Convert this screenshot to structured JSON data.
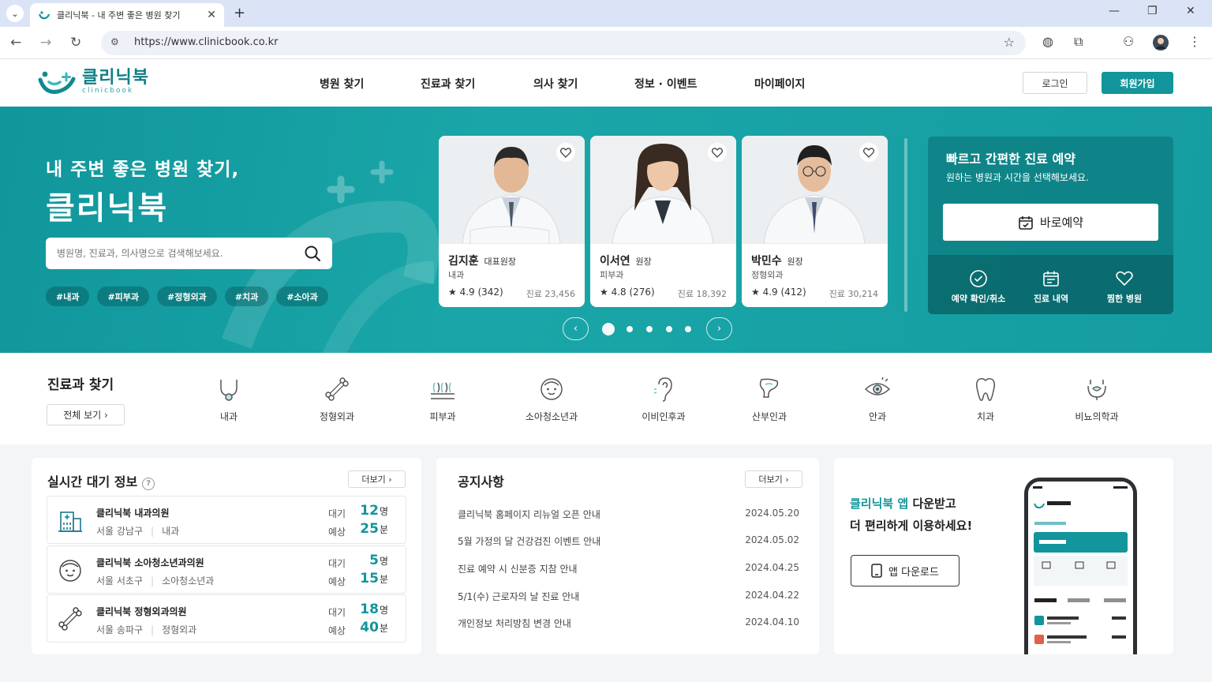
{
  "browser": {
    "tab_title": "클리닉북 - 내 주변 좋은 병원 찾기",
    "url": "https://www.clinicbook.co.kr"
  },
  "header": {
    "logo_ko": "클리닉북",
    "logo_en": "clinicbook",
    "nav": [
      "병원 찾기",
      "진료과 찾기",
      "의사 찾기",
      "정보 · 이벤트",
      "마이페이지"
    ],
    "login": "로그인",
    "signup": "회원가입"
  },
  "hero": {
    "subtitle": "내 주변 좋은 병원 찾기,",
    "title": "클리닉북",
    "search_placeholder": "병원명, 진료과, 의사명으로 검색해보세요.",
    "tags": [
      "#내과",
      "#피부과",
      "#정형외과",
      "#치과",
      "#소아과"
    ],
    "doctors": [
      {
        "name": "김지훈",
        "role": "대표원장",
        "dept": "내과",
        "rating": "★ 4.9 (342)",
        "count": "진료 23,456"
      },
      {
        "name": "이서연",
        "role": "원장",
        "dept": "피부과",
        "rating": "★ 4.8 (276)",
        "count": "진료 18,392"
      },
      {
        "name": "박민수",
        "role": "원장",
        "dept": "정형외과",
        "rating": "★ 4.9 (412)",
        "count": "진료 30,214"
      }
    ],
    "carousel": {
      "active_index": 0,
      "dot_count": 5
    }
  },
  "booking": {
    "title": "빠르고 간편한 진료 예약",
    "subtitle": "원하는 병원과 시간을 선택해보세요.",
    "button": "바로예약",
    "quick": [
      "예약 확인/취소",
      "진료 내역",
      "찜한 병원"
    ]
  },
  "departments": {
    "title": "진료과 찾기",
    "all_button": "전체 보기 ›",
    "items": [
      "내과",
      "정형외과",
      "피부과",
      "소아청소년과",
      "이비인후과",
      "산부인과",
      "안과",
      "치과",
      "비뇨의학과"
    ]
  },
  "wait": {
    "title": "실시간 대기 정보",
    "more": "더보기 ›",
    "wait_label": "대기",
    "eta_label": "예상",
    "rows": [
      {
        "name": "클리닉북 내과의원",
        "area": "서울 강남구",
        "dept": "내과",
        "wait": "12",
        "wait_unit": "명",
        "eta": "25",
        "eta_unit": "분"
      },
      {
        "name": "클리닉북 소아청소년과의원",
        "area": "서울 서초구",
        "dept": "소아청소년과",
        "wait": "5",
        "wait_unit": "명",
        "eta": "15",
        "eta_unit": "분"
      },
      {
        "name": "클리닉북 정형외과의원",
        "area": "서울 송파구",
        "dept": "정형외과",
        "wait": "18",
        "wait_unit": "명",
        "eta": "40",
        "eta_unit": "분"
      }
    ]
  },
  "notices": {
    "title": "공지사항",
    "more": "더보기 ›",
    "items": [
      {
        "text": "클리닉북 홈페이지 리뉴얼 오픈 안내",
        "date": "2024.05.20"
      },
      {
        "text": "5월 가정의 달 건강검진 이벤트 안내",
        "date": "2024.05.02"
      },
      {
        "text": "진료 예약 시 신분증 지참 안내",
        "date": "2024.04.25"
      },
      {
        "text": "5/1(수) 근로자의 날 진료 안내",
        "date": "2024.04.22"
      },
      {
        "text": "개인정보 처리방침 변경 안내",
        "date": "2024.04.10"
      }
    ]
  },
  "app": {
    "line1_highlight": "클리닉북 앱",
    "line1_rest": " 다운받고",
    "line2": "더 편리하게 이용하세요!",
    "button": "앱 다운로드"
  },
  "colors": {
    "brand": "#12959b",
    "hero_bg": "#159da1"
  }
}
